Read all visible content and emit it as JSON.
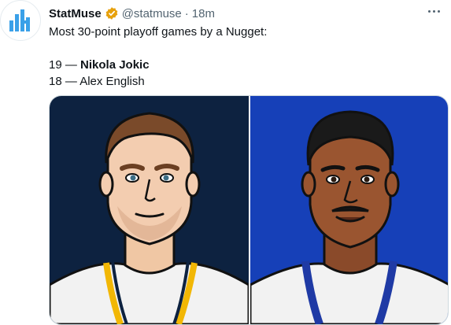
{
  "author": {
    "display_name": "StatMuse",
    "handle": "@statmuse",
    "separator": "·",
    "time": "18m",
    "verified_icon": "verified-badge-icon",
    "avatar_icon": "statmuse-logo-icon"
  },
  "tweet": {
    "line1": "Most 30-point playoff games by a Nugget:",
    "rank1_count": "19 —",
    "rank1_name": "Nikola Jokic",
    "rank2": "18 — Alex English"
  },
  "media": {
    "left_player_icon": "nikola-jokic-illustration",
    "right_player_icon": "alex-english-illustration"
  },
  "colors": {
    "brand_blue": "#1d9bf0",
    "left_bg": "#0d2240",
    "right_bg": "#1640b8",
    "nuggets_gold": "#f2b705"
  }
}
